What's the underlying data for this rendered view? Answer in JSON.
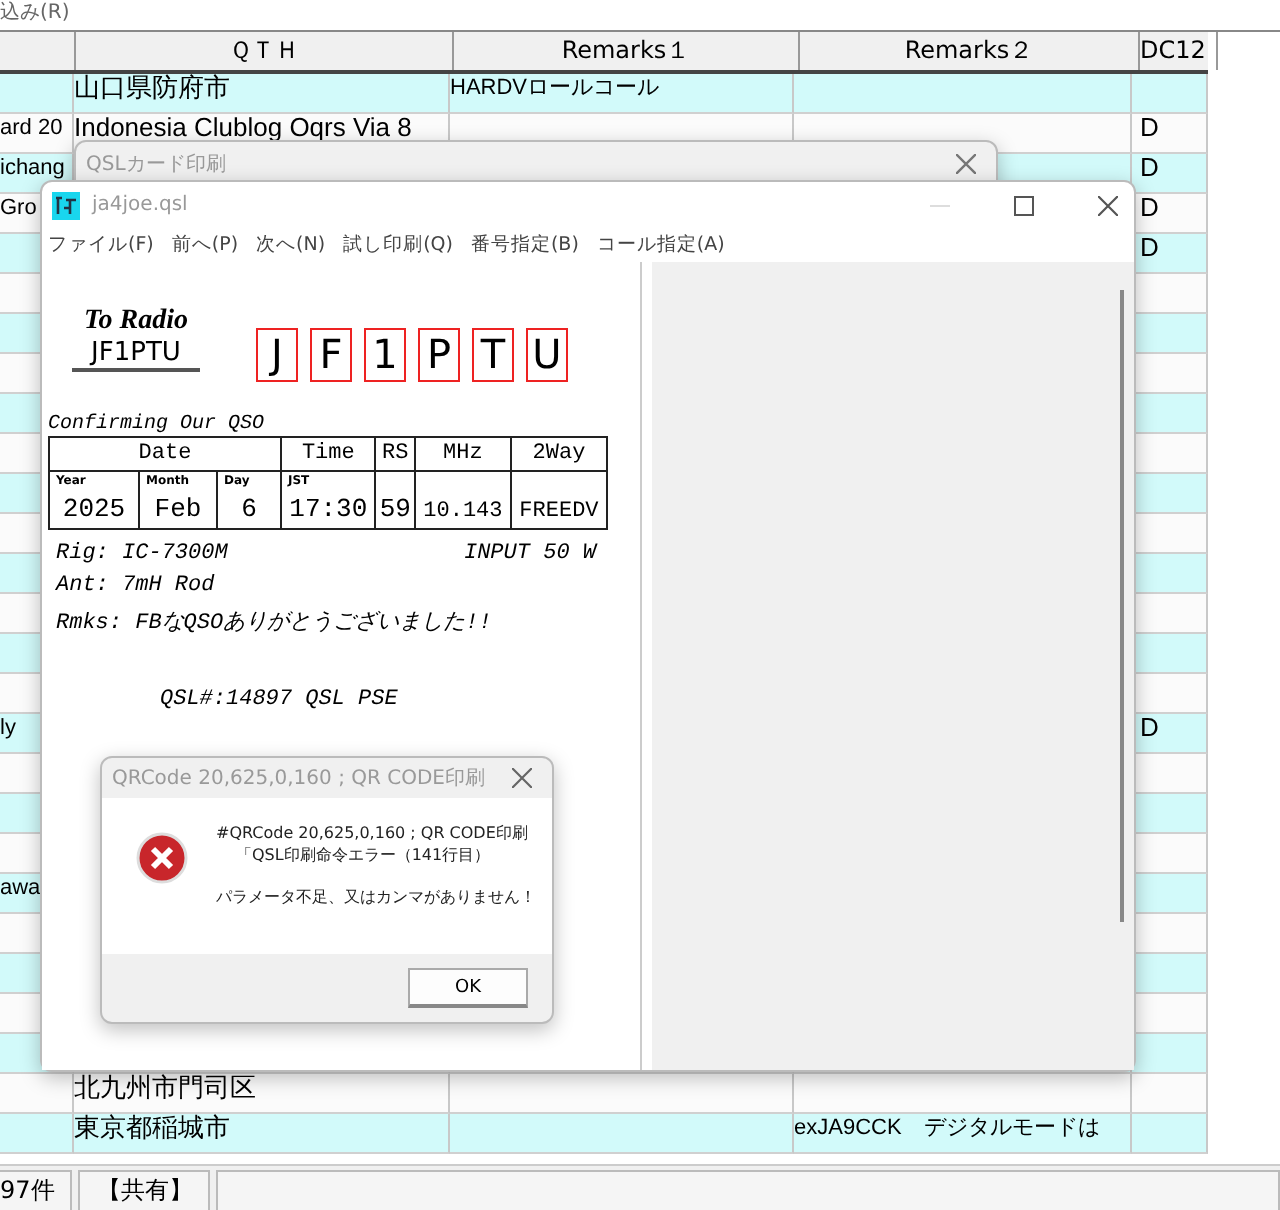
{
  "menu": {
    "label": "込み(R)"
  },
  "grid": {
    "columns": [
      "ＱＴＨ",
      "Remarks１",
      "Remarks２",
      "DC12"
    ],
    "rows": [
      {
        "qth": "山口県防府市",
        "remarks1": "HARDVロールコール"
      },
      {
        "col_1": "ard 20",
        "qth": "Indonesia  Clublog Oqrs Via 8",
        "dc12": "D"
      },
      {
        "col_1": "ichang",
        "dc12": "D"
      },
      {
        "col_1": "Gro",
        "dc12": "D"
      },
      {
        "dc12": "D"
      },
      {},
      {},
      {},
      {},
      {},
      {},
      {},
      {},
      {},
      {},
      {},
      {
        "col_1": "ly",
        "dc12": "D"
      },
      {},
      {},
      {},
      {
        "col_1": "awa"
      },
      {},
      {},
      {},
      {},
      {
        "qth": "北九州市門司区"
      },
      {
        "qth": "東京都稲城市",
        "remarks2": "exJA9CCK　デジタルモードは"
      }
    ]
  },
  "status_bar": [
    "97件",
    "【共有】"
  ],
  "back_window": {
    "title": "QSLカード印刷"
  },
  "qsl_window": {
    "title": "ja4joe.qsl",
    "menu": [
      "ファイル(F)",
      "前へ(P)",
      "次へ(N)",
      "試し印刷(Q)",
      "番号指定(B)",
      "コール指定(A)"
    ],
    "card": {
      "to_label": "To Radio",
      "to_call": "JF1PTU",
      "call_letters": [
        "J",
        "F",
        "1",
        "P",
        "T",
        "U"
      ],
      "confirming": "Confirming Our QSO",
      "headers": [
        "Date",
        "Time",
        "RS",
        "MHz",
        "2Way"
      ],
      "sub_labels": [
        "Year",
        "Month",
        "Day",
        "JST"
      ],
      "values": [
        "2025",
        "Feb",
        "6",
        "17:30",
        "59",
        "10.143",
        "FREEDV"
      ],
      "rig": "Rig:  IC-7300M",
      "power": "INPUT 50 W",
      "ant": "Ant: 7mH Rod",
      "remarks": "Rmks: FBなQSOありがとうございました!!",
      "qsl_line": "QSL#:14897  QSL PSE"
    }
  },
  "dialog": {
    "title": "QRCode 20,625,0,160 ; QR CODE印刷",
    "lines": [
      "#QRCode 20,625,0,160 ; QR CODE印刷",
      "「QSL印刷命令エラー（141行目）"
    ],
    "message": "パラメータ不足、又はカンマがありません！",
    "button": "OK"
  }
}
